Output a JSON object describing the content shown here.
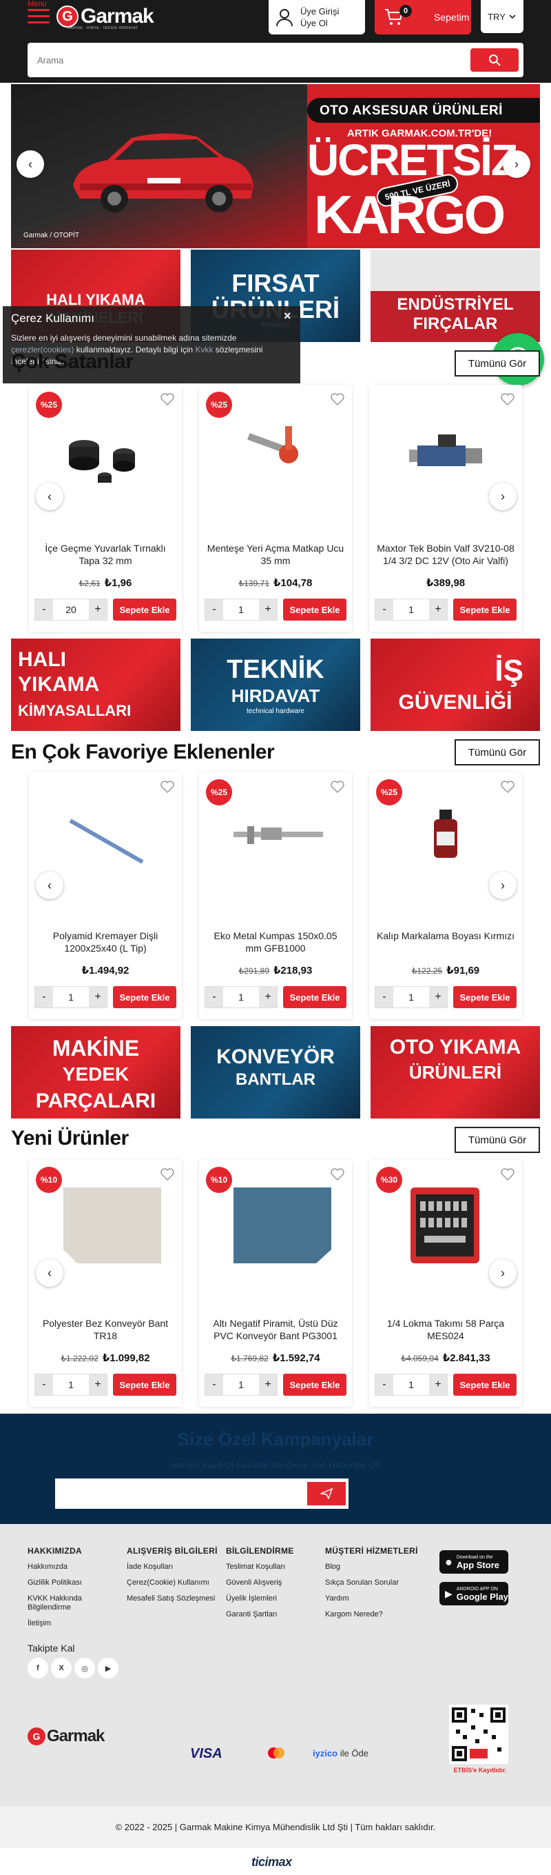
{
  "header": {
    "menu_label": "Menu",
    "logo_text": "Garmak",
    "logo_sub": "MAKİNE · KİMYA · TEKNİK HIRDAVAT",
    "login_line1": "Üye Girişi",
    "login_line2": "Üye Ol",
    "cart_count": "0",
    "cart_label": "Sepetim",
    "currency": "TRY"
  },
  "search": {
    "placeholder": "Arama"
  },
  "hero": {
    "line1": "OTO AKSESUAR ÜRÜNLERİ",
    "line2": "ARTIK GARMAK.COM.TR'DE!",
    "big1": "ÜCRETSİZ",
    "big2": "KARGO",
    "badge": "500 TL VE ÜZERİ",
    "brand": "Garmak / OTOPİT"
  },
  "banners_top": [
    {
      "title": "HALI YIKAMA MAKİNELERİ",
      "sub": ""
    },
    {
      "title": "FIRSAT ÜRÜNLERİ",
      "sub": "Products"
    },
    {
      "title": "ENDÜSTRİYEL FIRÇALAR",
      "sub": ""
    }
  ],
  "cookie": {
    "title": "Çerez Kullanımı",
    "text1": "Sizlere en iyi alışveriş deneyimini sunabilmek adına sitemizde",
    "link1": "çerezler(cookies)",
    "text2": " kullanmaktayız. Detaylı bilgi için ",
    "link2": "Kvkk",
    "text3": " sözleşmesini incelebilirsiniz.",
    "close": "×"
  },
  "sections": {
    "bestsellers_title": "Çok Satanlar",
    "favorites_title": "En Çok Favoriye Eklenenler",
    "new_title": "Yeni Ürünler",
    "see_all": "Tümünü Gör"
  },
  "bestsellers": [
    {
      "discount": "%25",
      "name": "İçe Geçme Yuvarlak Tırnaklı Tapa 32 mm",
      "old": "₺2,61",
      "price": "₺1,96",
      "qty": "20"
    },
    {
      "discount": "%25",
      "name": "Menteşe Yeri Açma Matkap Ucu 35 mm",
      "old": "₺139,71",
      "price": "₺104,78",
      "qty": "1"
    },
    {
      "discount": "",
      "name": "Maxtor Tek Bobin Valf 3V210-08 1/4 3/2 DC 12V (Oto Air Valfi)",
      "old": "",
      "price": "₺389,98",
      "qty": "1"
    }
  ],
  "banners_mid": [
    {
      "title1": "HALI",
      "title2": "YIKAMA",
      "title3": "KİMYASALLARI"
    },
    {
      "title1": "TEKNİK",
      "title2": "HIRDAVAT",
      "title3": "technical hardware"
    },
    {
      "title1": "İŞ",
      "title2": "GÜVENLİĞİ",
      "title3": ""
    }
  ],
  "favorites": [
    {
      "discount": "",
      "name": "Polyamid Kremayer Dişli 1200x25x40 (L Tip)",
      "old": "",
      "price": "₺1.494,92",
      "qty": "1"
    },
    {
      "discount": "%25",
      "name": "Eko Metal Kumpas 150x0.05 mm GFB1000",
      "old": "₺291,89",
      "price": "₺218,93",
      "qty": "1"
    },
    {
      "discount": "%25",
      "name": "Kalıp Markalama Boyası Kırmızı",
      "old": "₺122,25",
      "price": "₺91,69",
      "qty": "1"
    }
  ],
  "banners_low": [
    {
      "title1": "MAKİNE",
      "title2": "YEDEK",
      "title3": "PARÇALARI"
    },
    {
      "title1": "KONVEYÖR",
      "title2": "BANTLAR",
      "title3": ""
    },
    {
      "title1": "OTO YIKAMA",
      "title2": "ÜRÜNLERİ",
      "title3": ""
    }
  ],
  "new_products": [
    {
      "discount": "%10",
      "name": "Polyester Bez Konveyör Bant TR18",
      "old": "₺1.222,02",
      "price": "₺1.099,82",
      "qty": "1"
    },
    {
      "discount": "%10",
      "name": "Altı Negatif Piramit, Üstü Düz PVC Konveyör Bant PG3001",
      "old": "₺1.769,82",
      "price": "₺1.592,74",
      "qty": "1"
    },
    {
      "discount": "%30",
      "name": "1/4 Lokma Takımı 58 Parça MES024",
      "old": "₺4.059,04",
      "price": "₺2.841,33",
      "qty": "1"
    }
  ],
  "add_to_cart": "Sepete Ekle",
  "newsletter": {
    "title": "Size Özel Kampanyalar",
    "subtitle": "Hemen Kayıt Ol Fırsatlardan Önce Sen Haberdar Ol!"
  },
  "footer": {
    "col1": {
      "title": "HAKKIMIZDA",
      "items": [
        "Hakkımızda",
        "Gizlilik Politikası",
        "KVKK Hakkında Bilgilendirme",
        "İletişim"
      ]
    },
    "col2": {
      "title": "ALIŞVERİŞ BİLGİLERİ",
      "items": [
        "İade Koşulları",
        "Çerez(Cookie) Kullanımı",
        "Mesafeli Satış Sözleşmesi"
      ]
    },
    "col3": {
      "title": "BİLGİLENDİRME",
      "items": [
        "Teslimat Koşulları",
        "Güvenli Alışveriş",
        "Üyelik İşlemleri",
        "Garanti Şartları"
      ]
    },
    "col4": {
      "title": "MÜŞTERİ HİZMETLERİ",
      "items": [
        "Blog",
        "Sıkça Sorulan Sorular",
        "Yardım",
        "Kargom Nerede?"
      ]
    },
    "appstore_small": "Download on the",
    "appstore": "App Store",
    "googleplay_small": "ANDROID APP ON",
    "googleplay": "Google Play",
    "follow": "Takipte Kal",
    "social": [
      "f",
      "X",
      "◎",
      "▶"
    ],
    "pay_visa": "VISA",
    "pay_iyzico": "iyzico",
    "pay_iyzico_suffix": "ile Öde",
    "etbis": "ETBİS'e Kayıtlıdır.",
    "copyright": "© 2022 - 2025 | Garmak Makine Kimya Mühendislik Ltd Şti | Tüm hakları saklıdır.",
    "ticimax": "ticimax"
  }
}
